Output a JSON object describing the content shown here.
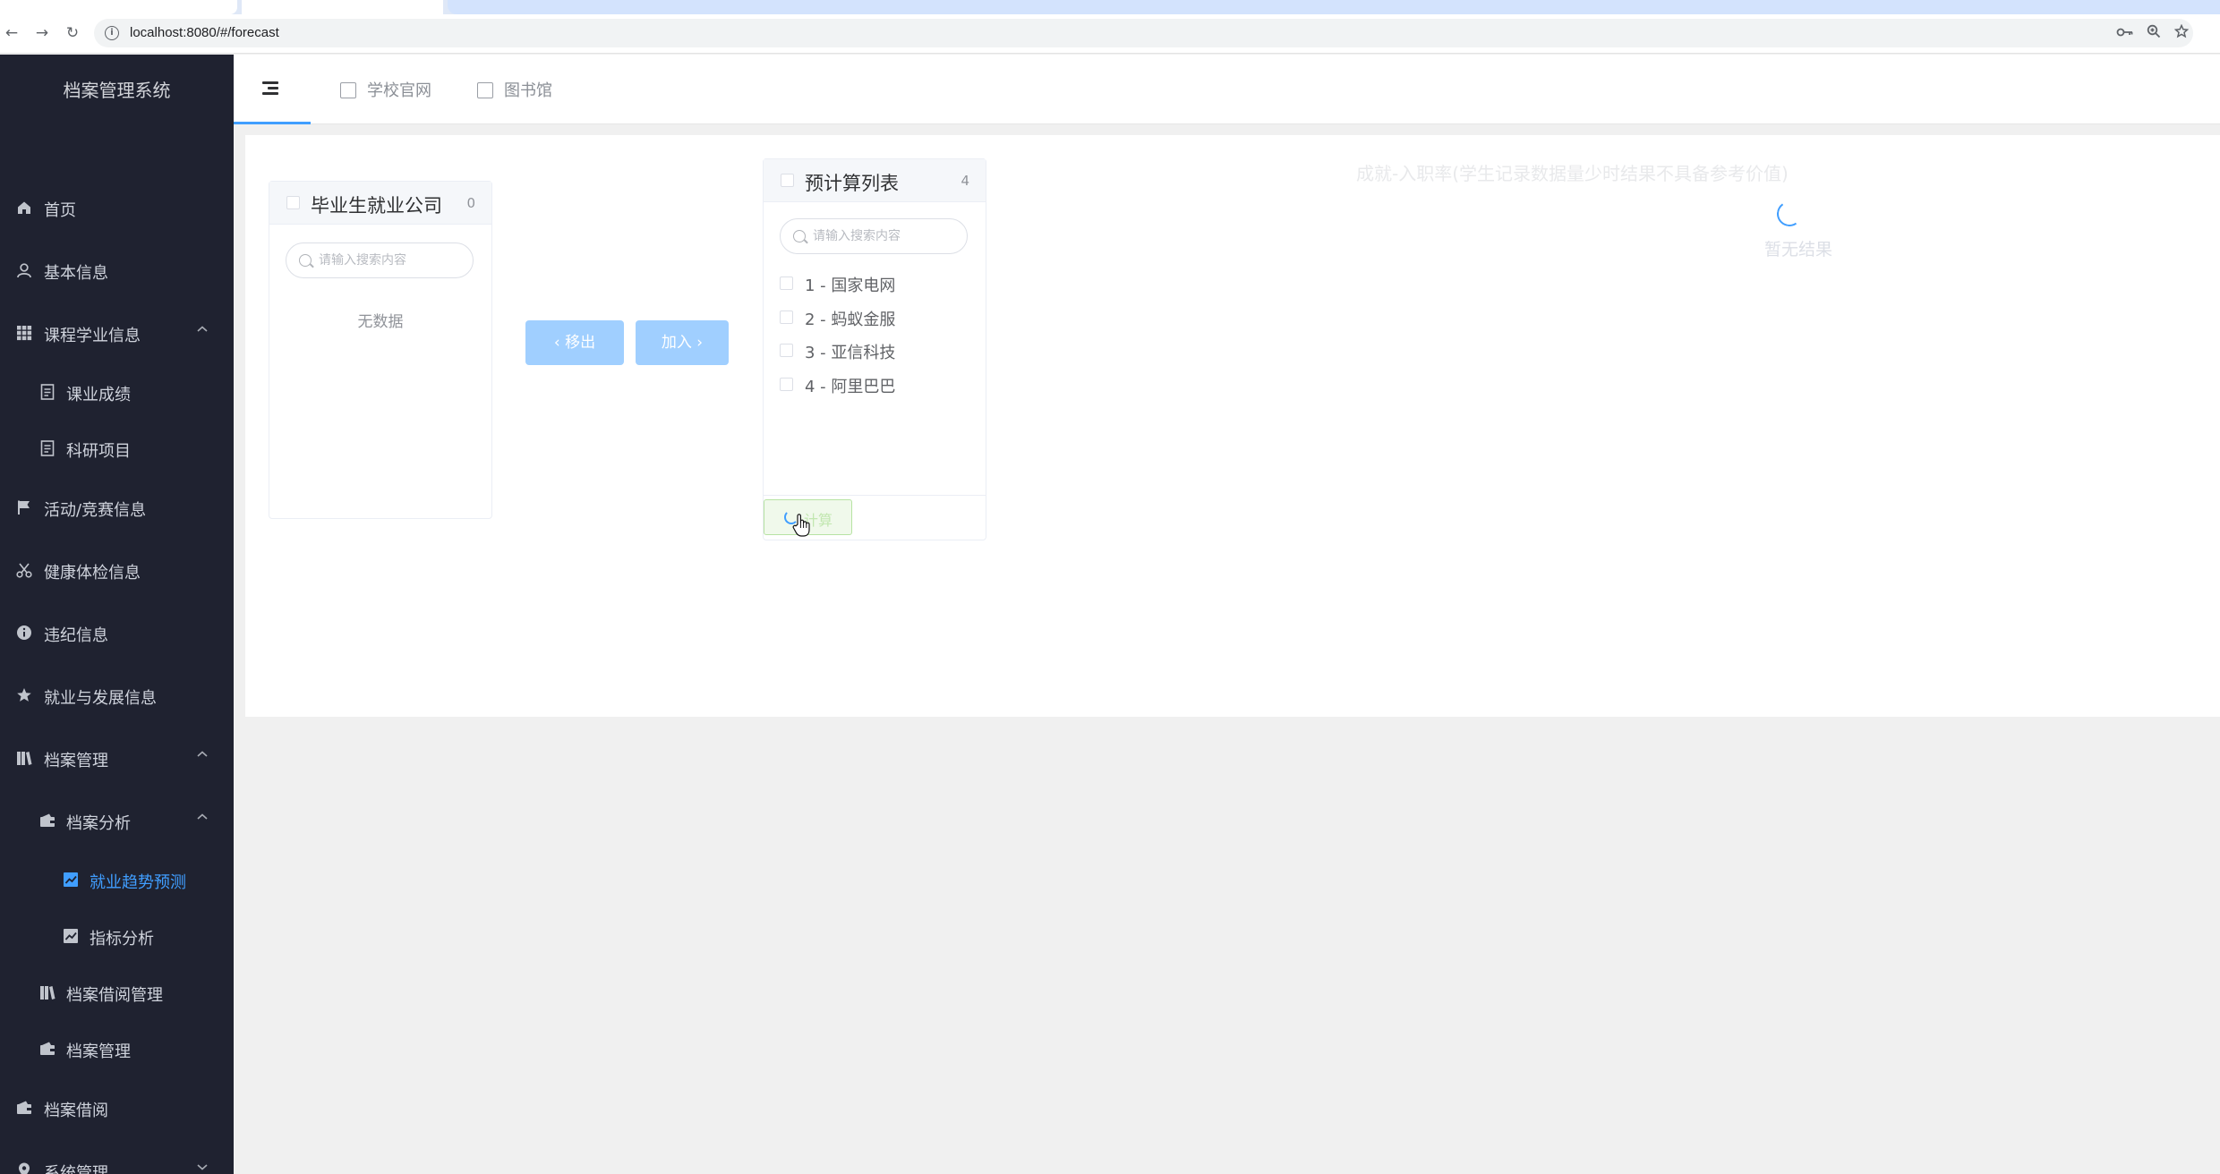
{
  "browser": {
    "url": "localhost:8080/#/forecast",
    "nav": {
      "back_icon": "←",
      "forward_icon": "→",
      "reload_icon": "↻"
    },
    "right_icons": [
      "key-icon",
      "zoom-icon",
      "star-icon"
    ]
  },
  "sidebar": {
    "title": "档案管理系统",
    "items": [
      {
        "label": "首页",
        "icon": "home-icon"
      },
      {
        "label": "基本信息",
        "icon": "user-icon"
      },
      {
        "label": "课程学业信息",
        "icon": "grid-icon",
        "expanded": true
      },
      {
        "label": "课业成绩",
        "icon": "document-icon"
      },
      {
        "label": "科研项目",
        "icon": "document-icon"
      },
      {
        "label": "活动/竞赛信息",
        "icon": "flag-icon"
      },
      {
        "label": "健康体检信息",
        "icon": "scissors-icon"
      },
      {
        "label": "违纪信息",
        "icon": "info-icon"
      },
      {
        "label": "就业与发展信息",
        "icon": "star-icon"
      },
      {
        "label": "档案管理",
        "icon": "books-icon",
        "expanded": true
      },
      {
        "label": "档案分析",
        "icon": "wallet-icon",
        "expanded": true
      },
      {
        "label": "就业趋势预测",
        "icon": "chart-icon",
        "active": true
      },
      {
        "label": "指标分析",
        "icon": "chart-icon"
      },
      {
        "label": "档案借阅管理",
        "icon": "books-icon"
      },
      {
        "label": "档案管理",
        "icon": "wallet-icon"
      },
      {
        "label": "档案借阅",
        "icon": "wallet-icon"
      },
      {
        "label": "系统管理",
        "icon": "location-icon",
        "expanded": false
      }
    ],
    "colors": {
      "background": "#1f2230",
      "active": "#409eff"
    }
  },
  "header": {
    "links": [
      {
        "label": "学校官网",
        "icon": "building-icon"
      },
      {
        "label": "图书馆",
        "icon": "copy-icon"
      }
    ]
  },
  "transfer": {
    "left": {
      "title": "毕业生就业公司",
      "count": "0",
      "search_placeholder": "请输入搜索内容",
      "empty_text": "无数据"
    },
    "right": {
      "title": "预计算列表",
      "count": "4",
      "search_placeholder": "请输入搜索内容",
      "items": [
        "1 - 国家电网",
        "2 - 蚂蚁金服",
        "3 - 亚信科技",
        "4 - 阿里巴巴"
      ],
      "footer_button": "计算"
    },
    "buttons": {
      "remove": "移出",
      "add": "加入"
    }
  },
  "chart": {
    "title": "成就-入职率(学生记录数据量少时结果不具备参考价值)",
    "empty_text": "暂无结果",
    "loading": true
  }
}
